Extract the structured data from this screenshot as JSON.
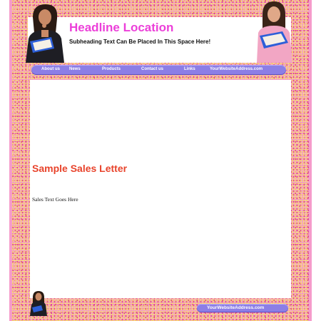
{
  "header": {
    "headline": "Headline Location",
    "subheading": "Subheading Text Can Be Placed In This Space Here!"
  },
  "nav": {
    "items": [
      {
        "label": "About us"
      },
      {
        "label": "News"
      },
      {
        "label": "Products"
      },
      {
        "label": "Contact us"
      },
      {
        "label": "Links"
      },
      {
        "label": "YourWebsiteAddress.com"
      }
    ]
  },
  "content": {
    "title": "Sample Sales Letter",
    "body": "Sales Text Goes Here"
  },
  "footer": {
    "website": "YourWebsiteAddress.com"
  },
  "colors": {
    "frame_pink": "#f29ac4",
    "headline_magenta": "#ec3fd9",
    "nav_purple": "#8c7ee6",
    "title_red": "#e8432b"
  }
}
